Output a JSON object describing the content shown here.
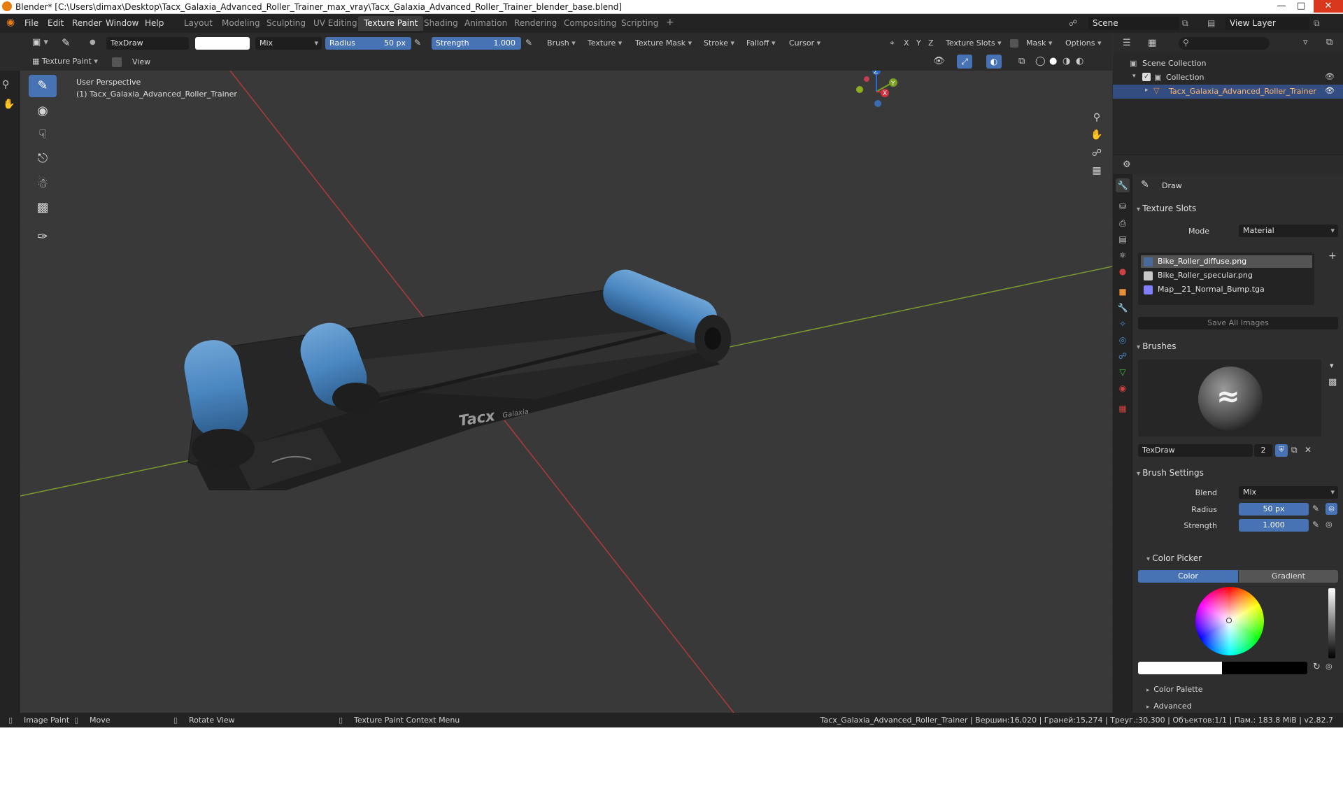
{
  "window": {
    "title": "Blender* [C:\\Users\\dimax\\Desktop\\Tacx_Galaxia_Advanced_Roller_Trainer_max_vray\\Tacx_Galaxia_Advanced_Roller_Trainer_blender_base.blend]"
  },
  "menu": {
    "items": [
      "File",
      "Edit",
      "Render",
      "Window",
      "Help"
    ],
    "workspaces": [
      "Layout",
      "Modeling",
      "Sculpting",
      "UV Editing",
      "Texture Paint",
      "Shading",
      "Animation",
      "Rendering",
      "Compositing",
      "Scripting"
    ],
    "active_workspace": "Texture Paint",
    "add_tab": "+",
    "scene": "Scene",
    "view_layer": "View Layer"
  },
  "tool_header": {
    "brush_name": "TexDraw",
    "blend": "Mix",
    "radius_label": "Radius",
    "radius_value": "50 px",
    "strength_label": "Strength",
    "strength_value": "1.000",
    "menus": [
      "Brush",
      "Texture",
      "Texture Mask",
      "Stroke",
      "Falloff",
      "Cursor"
    ],
    "axes": [
      "X",
      "Y",
      "Z"
    ],
    "texture_slots": "Texture Slots",
    "mask": "Mask",
    "options": "Options"
  },
  "header2": {
    "mode": "Texture Paint",
    "view": "View"
  },
  "viewport": {
    "perspective": "User Perspective",
    "object": "(1) Tacx_Galaxia_Advanced_Roller_Trainer",
    "logo_text": "Tacx",
    "logo_sub": "Galaxia",
    "gizmo": {
      "x": "X",
      "y": "Y",
      "z": "Z"
    }
  },
  "outliner": {
    "scene_collection": "Scene Collection",
    "collection": "Collection",
    "object": "Tacx_Galaxia_Advanced_Roller_Trainer"
  },
  "properties": {
    "tool": "Draw",
    "texture_slots": {
      "title": "Texture Slots",
      "mode_label": "Mode",
      "mode_value": "Material",
      "slots": [
        {
          "name": "Bike_Roller_diffuse.png",
          "color": "#4a6a9a"
        },
        {
          "name": "Bike_Roller_specular.png",
          "color": "#c8c8c8"
        },
        {
          "name": "Map__21_Normal_Bump.tga",
          "color": "#8080ff"
        }
      ],
      "save_all": "Save All Images"
    },
    "brushes": {
      "title": "Brushes",
      "name": "TexDraw",
      "users": "2"
    },
    "brush_settings": {
      "title": "Brush Settings",
      "blend_label": "Blend",
      "blend_value": "Mix",
      "radius_label": "Radius",
      "radius_value": "50 px",
      "strength_label": "Strength",
      "strength_value": "1.000"
    },
    "color_picker": {
      "title": "Color Picker",
      "tab_color": "Color",
      "tab_gradient": "Gradient"
    },
    "color_palette": "Color Palette",
    "advanced": "Advanced"
  },
  "status_bar": {
    "image_paint": "Image Paint",
    "move": "Move",
    "rotate_view": "Rotate View",
    "context_menu": "Texture Paint Context Menu",
    "stats": "Tacx_Galaxia_Advanced_Roller_Trainer | Вершин:16,020 | Граней:15,274 | Треуг.:30,300 | Объектов:1/1 | Пам.: 183.8 MiB | v2.82.7"
  },
  "colors": {
    "accent": "#4772b3",
    "roller_blue": "#4a86c0",
    "frame_dark": "#242424",
    "grid_red": "#b03a3a",
    "grid_green": "#7a9a30"
  }
}
